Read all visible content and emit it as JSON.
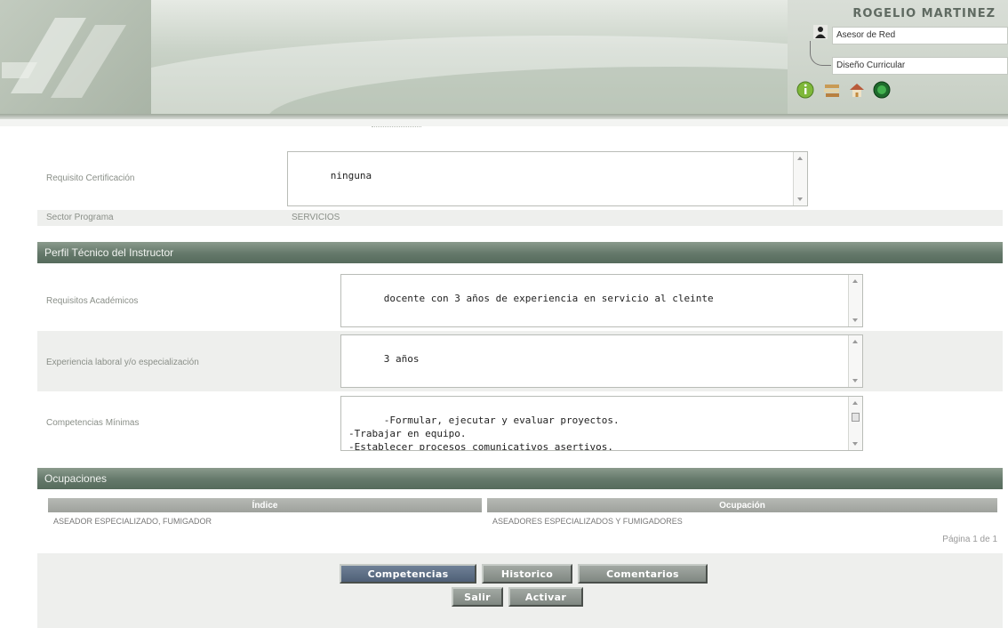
{
  "header": {
    "user_name": "ROGELIO MARTINEZ",
    "role_primary": "Asesor de Red",
    "role_secondary": "Diseño Curricular",
    "icons": [
      "help-icon",
      "books-icon",
      "home-icon",
      "power-icon"
    ]
  },
  "form": {
    "requisito_certificacion": {
      "label": "Requisito Certificación",
      "value": "ninguna"
    },
    "sector_programa": {
      "label": "Sector Programa",
      "value": "SERVICIOS"
    }
  },
  "perfil": {
    "section_title": "Perfil Técnico del Instructor",
    "requisitos_academicos": {
      "label": "Requisitos Académicos",
      "value": "docente con 3 años de experiencia en servicio al cleinte"
    },
    "experiencia": {
      "label": "Experiencia laboral y/o especialización",
      "value": "3 años"
    },
    "competencias_minimas": {
      "label": "Competencias Mínimas",
      "value": "-Formular, ejecutar y evaluar proyectos.\n-Trabajar en equipo.\n-Establecer procesos comunicativos asertivos."
    }
  },
  "ocupaciones": {
    "section_title": "Ocupaciones",
    "columns": [
      "Índice",
      "Ocupación"
    ],
    "rows": [
      [
        "ASEADOR ESPECIALIZADO, FUMIGADOR",
        "ASEADORES ESPECIALIZADOS Y FUMIGADORES"
      ]
    ],
    "pager": "Página 1 de 1"
  },
  "buttons": {
    "competencias": "Competencias",
    "historico": "Historico",
    "comentarios": "Comentarios",
    "salir": "Salir",
    "activar": "Activar"
  },
  "colors": {
    "section_bar": "#64786a",
    "button_primary": "#5a6b82",
    "button_default": "#8b928c"
  }
}
